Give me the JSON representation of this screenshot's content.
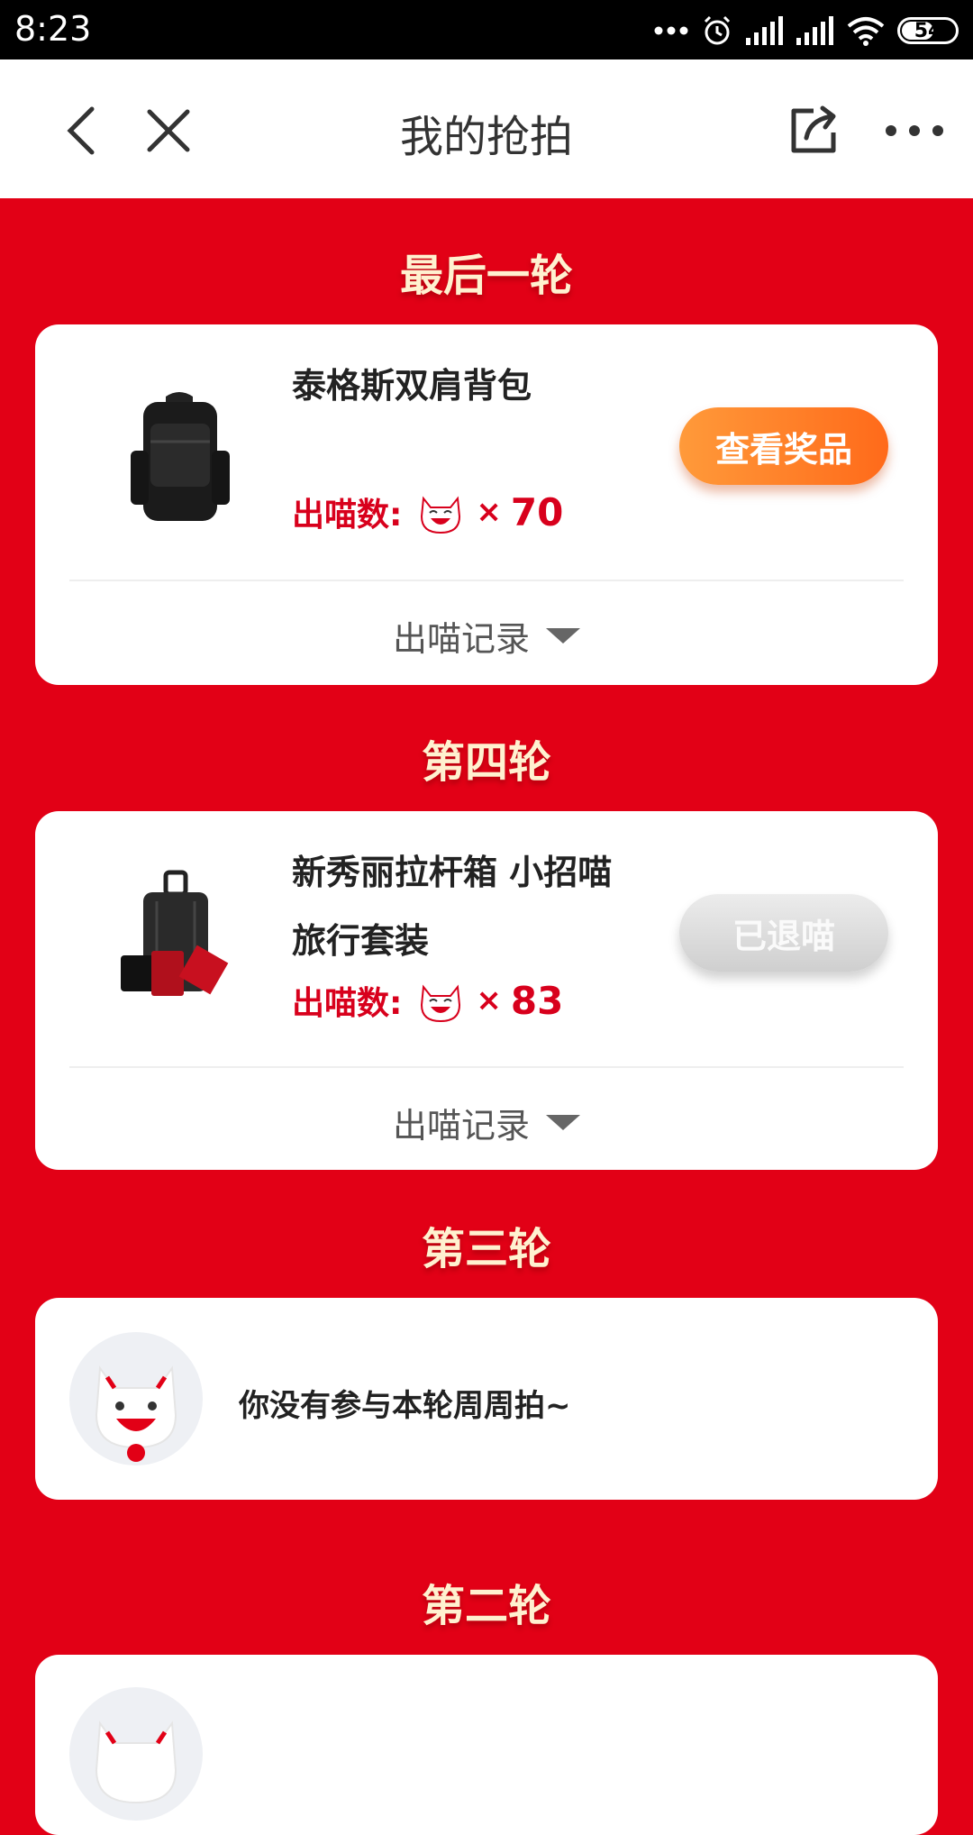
{
  "status_bar": {
    "time": "8:23",
    "battery": "54"
  },
  "nav": {
    "title": "我的抢拍"
  },
  "rounds": [
    {
      "title": "最后一轮",
      "product_name": "泰格斯双肩背包",
      "count_label": "出喵数:",
      "count_prefix": "×",
      "count": "70",
      "button": "查看奖品",
      "record_label": "出喵记录"
    },
    {
      "title": "第四轮",
      "product_name": "新秀丽拉杆箱 小招喵旅行套装",
      "count_label": "出喵数:",
      "count_prefix": "×",
      "count": "83",
      "button": "已退喵",
      "record_label": "出喵记录"
    },
    {
      "title": "第三轮",
      "empty_message": "你没有参与本轮周周拍~"
    },
    {
      "title": "第二轮"
    }
  ],
  "colors": {
    "background": "#e20016",
    "accent_red": "#d8001c",
    "button_orange": "#ff7a22"
  }
}
